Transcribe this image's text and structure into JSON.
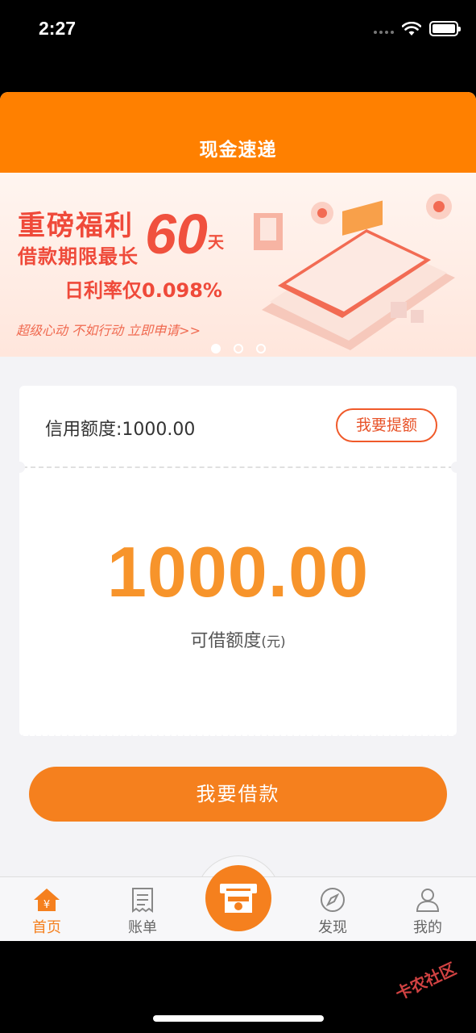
{
  "status": {
    "time": "2:27"
  },
  "nav": {
    "title": "现金速递"
  },
  "banner": {
    "line1": "重磅福利",
    "line2": "借款期限最长",
    "number": "60",
    "day": "天",
    "line3": "日利率仅0.098%",
    "line4": "超级心动 不如行动 立即申请>>",
    "slides": 3,
    "active_slide": 1
  },
  "card": {
    "credit_label": "信用额度:1000.00",
    "raise_button": "我要提额",
    "amount": "1000.00",
    "amount_label": "可借额度",
    "amount_unit": "(元)"
  },
  "borrow_button": "我要借款",
  "tabs": [
    {
      "label": "首页",
      "icon": "home-icon",
      "active": true
    },
    {
      "label": "账单",
      "icon": "bill-icon",
      "active": false
    },
    {
      "label": "发现",
      "icon": "compass-icon",
      "active": false
    },
    {
      "label": "我的",
      "icon": "user-icon",
      "active": false
    }
  ],
  "colors": {
    "primary": "#ff8000",
    "amount": "#f7942b",
    "accent_red": "#ef4a3a"
  },
  "watermark": "卡农社区"
}
